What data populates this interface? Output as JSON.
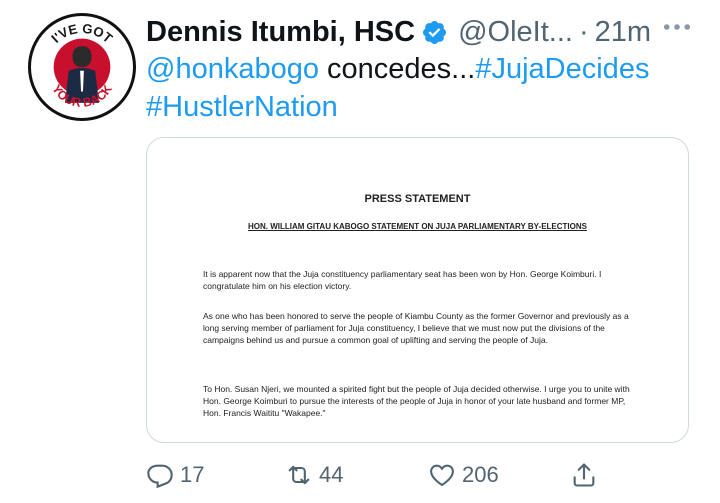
{
  "tweet": {
    "author_name": "Dennis Itumbi, HSC",
    "handle": "@OleIt...",
    "separator": "·",
    "time": "21m",
    "more_icon": "more-horizontal-icon",
    "text": {
      "mention": "@honkabogo",
      "body": " concedes...",
      "hashtag1": "#JujaDecides",
      "hashtag2": "#HustlerNation"
    },
    "avatar": {
      "badge_text_top": "I'VE GOT",
      "badge_text_bottom": "YOUR BACK"
    }
  },
  "document": {
    "title": "PRESS STATEMENT",
    "subtitle": "HON. WILLIAM GITAU KABOGO STATEMENT ON JUJA PARLIAMENTARY BY-ELECTIONS",
    "paragraphs": [
      "It is apparent now that the Juja constituency parliamentary seat has been won by Hon. George Koimburi. I congratulate him on his election victory.",
      "As one who has been honored to serve the people of Kiambu County as the former Governor and previously as a long serving member of parliament for Juja constituency, I believe that we must now put the divisions of the campaigns behind us and pursue a common goal of uplifting and serving the people of Juja.",
      "To Hon. Susan Njeri, we mounted a spirited fight but the people of Juja decided otherwise. I urge you to unite with Hon. George Koimburi to pursue the interests of the people of Juja in honor of your late husband and former MP, Hon. Francis Waititu \"Wakapee.\""
    ]
  },
  "actions": {
    "reply_count": "17",
    "retweet_count": "44",
    "like_count": "206"
  },
  "colors": {
    "link": "#1d9bf0",
    "secondary": "#536471",
    "verified": "#1d9bf0"
  }
}
